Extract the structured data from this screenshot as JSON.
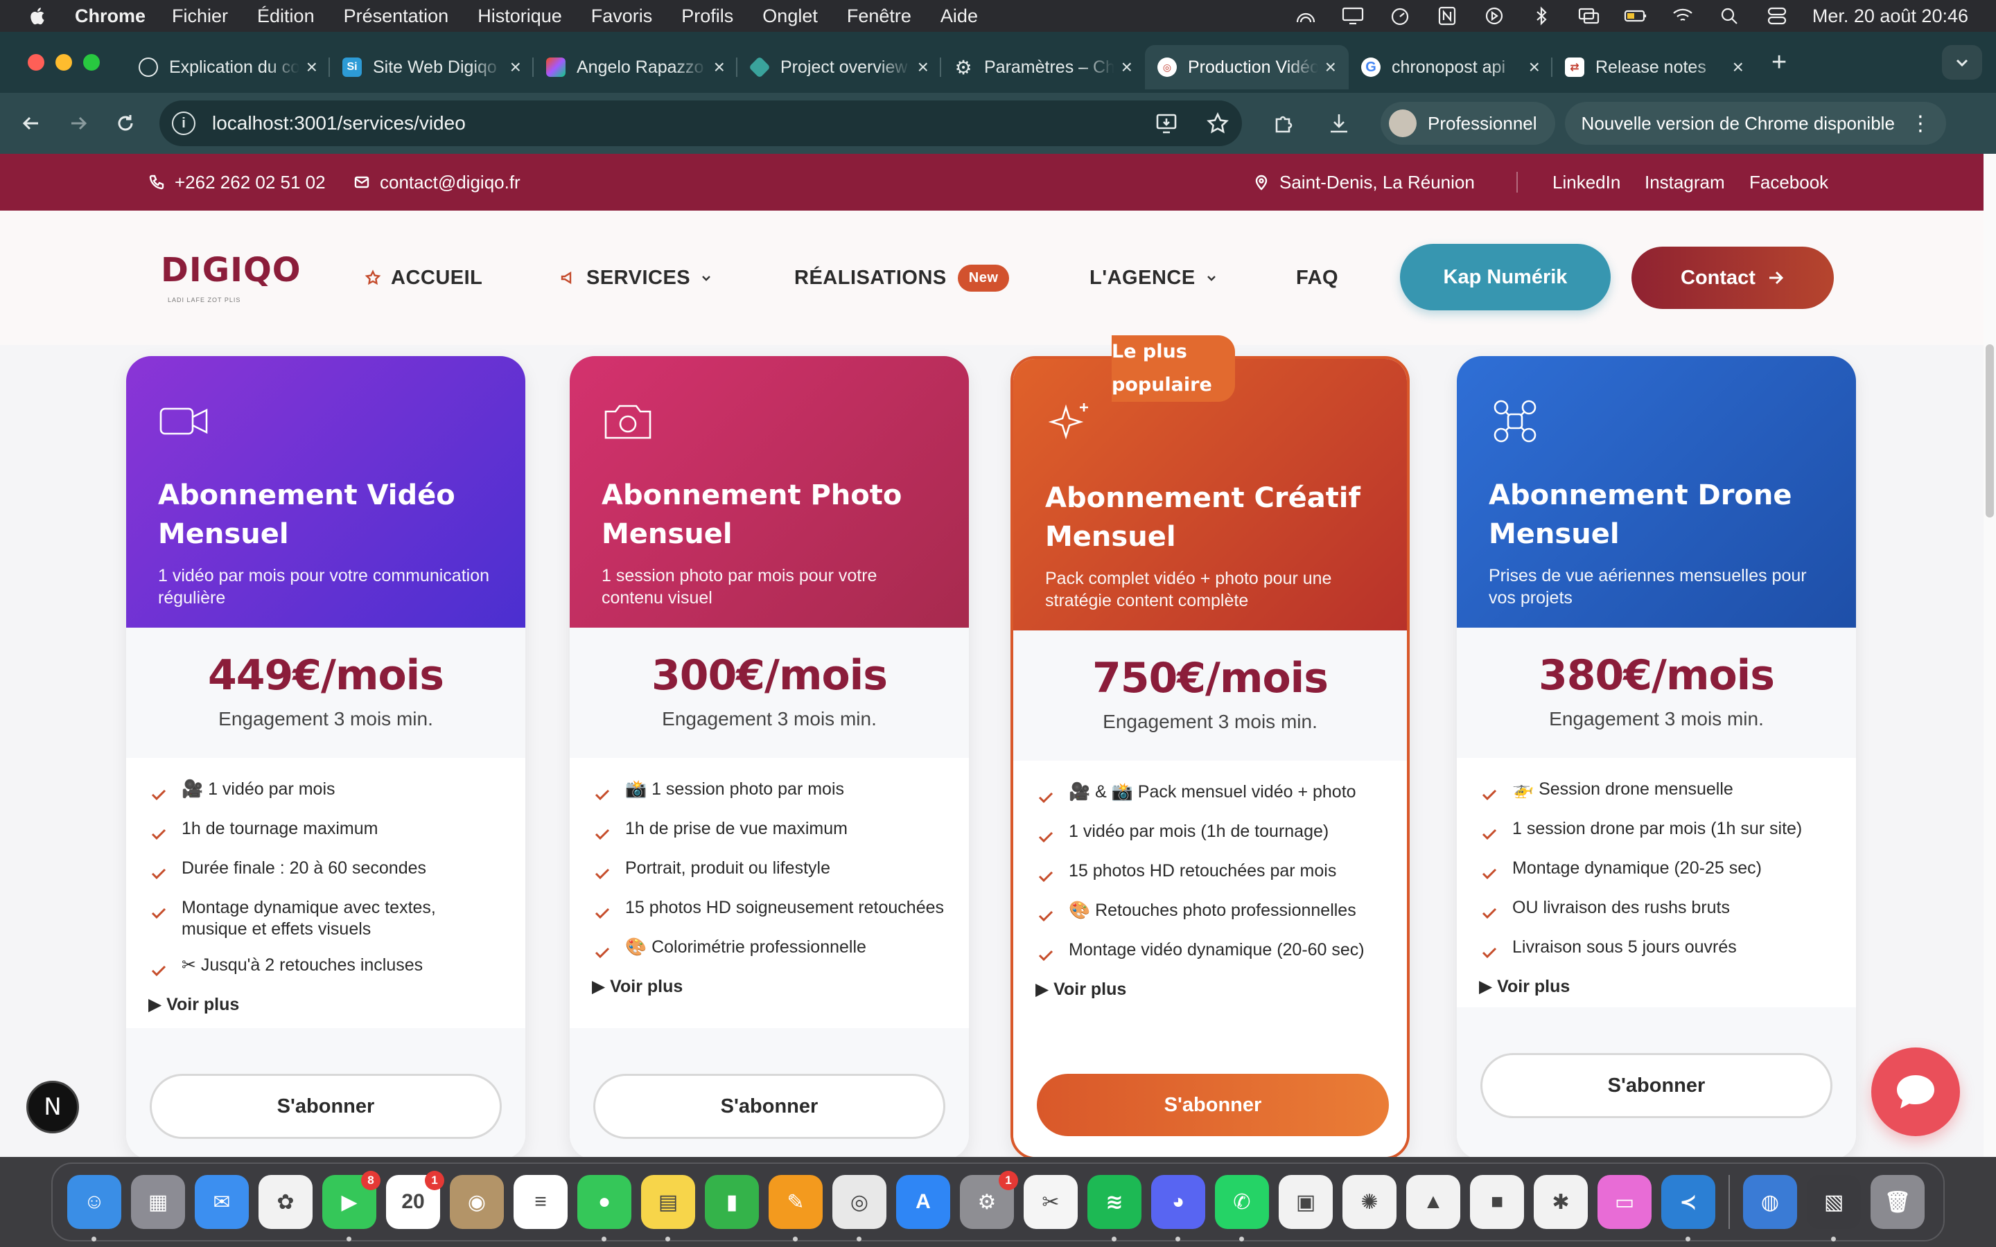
{
  "menubar": {
    "app": "Chrome",
    "items": [
      "Fichier",
      "Édition",
      "Présentation",
      "Historique",
      "Favoris",
      "Profils",
      "Onglet",
      "Fenêtre",
      "Aide"
    ],
    "datetime": "Mer. 20 août  20:46"
  },
  "tabs": [
    {
      "label": "Explication du code",
      "favicon": "openai-icon",
      "active": false
    },
    {
      "label": "Site Web Digiqo",
      "favicon": "si-icon",
      "active": false
    },
    {
      "label": "Angelo Rapazzo",
      "favicon": "figma-icon",
      "active": false
    },
    {
      "label": "Project overview",
      "favicon": "diamond-icon",
      "active": false
    },
    {
      "label": "Paramètres – Chrome",
      "favicon": "gear-icon",
      "active": false
    },
    {
      "label": "Production Vidéo",
      "favicon": "digiqo-icon",
      "active": true
    },
    {
      "label": "chronopost api",
      "favicon": "google-icon",
      "active": false
    },
    {
      "label": "Release notes",
      "favicon": "release-icon",
      "active": false
    }
  ],
  "toolbar": {
    "url": "localhost:3001/services/video",
    "profile": "Professionnel",
    "update": "Nouvelle version de Chrome disponible"
  },
  "topstrip": {
    "phone": "+262 262 02 51 02",
    "email": "contact@digiqo.fr",
    "location": "Saint-Denis, La Réunion",
    "socials": [
      "LinkedIn",
      "Instagram",
      "Facebook"
    ]
  },
  "header": {
    "logo": "DIGIQO",
    "logo_tagline": "LADI LAFE ZOT PLIS",
    "nav": {
      "home": "ACCUEIL",
      "services": "SERVICES",
      "realisations": "RÉALISATIONS",
      "new_badge": "New",
      "agency": "L'AGENCE",
      "faq": "FAQ"
    },
    "kap": "Kap Numérik",
    "contact": "Contact"
  },
  "popular_badge": "Le plus populaire",
  "plans": [
    {
      "title": "Abonnement Vidéo Mensuel",
      "subtitle": "1 vidéo par mois pour votre communication régulière",
      "price": "449€/mois",
      "engagement": "Engagement 3 mois min.",
      "features": [
        "🎥 1 vidéo par mois",
        "1h de tournage maximum",
        "Durée finale : 20 à 60 secondes",
        "Montage dynamique avec textes, musique et effets visuels",
        "✂ Jusqu'à 2 retouches incluses"
      ],
      "more": "▶ Voir plus",
      "cta": "S'abonner",
      "gradient": [
        "#8b35d6",
        "#4b2fd0"
      ],
      "icon": "video-camera-icon"
    },
    {
      "title": "Abonnement Photo Mensuel",
      "subtitle": "1 session photo par mois pour votre contenu visuel",
      "price": "300€/mois",
      "engagement": "Engagement 3 mois min.",
      "features": [
        "📸 1 session photo par mois",
        "1h de prise de vue maximum",
        "Portrait, produit ou lifestyle",
        "15 photos HD soigneusement retouchées",
        "🎨 Colorimétrie professionnelle"
      ],
      "more": "▶ Voir plus",
      "cta": "S'abonner",
      "gradient": [
        "#d4326e",
        "#a72a4e"
      ],
      "icon": "camera-icon"
    },
    {
      "title": "Abonnement Créatif Mensuel",
      "subtitle": "Pack complet vidéo + photo pour une stratégie content complète",
      "price": "750€/mois",
      "engagement": "Engagement 3 mois min.",
      "features": [
        "🎥 & 📸 Pack mensuel vidéo + photo",
        "1 vidéo par mois (1h de tournage)",
        "15 photos HD retouchées par mois",
        "🎨 Retouches photo professionnelles",
        "Montage vidéo dynamique (20-60 sec)"
      ],
      "more": "▶ Voir plus",
      "cta": "S'abonner",
      "gradient": [
        "#e0622a",
        "#b8322a"
      ],
      "icon": "sparkles-icon"
    },
    {
      "title": "Abonnement Drone Mensuel",
      "subtitle": "Prises de vue aériennes mensuelles pour vos projets",
      "price": "380€/mois",
      "engagement": "Engagement 3 mois min.",
      "features": [
        "🚁 Session drone mensuelle",
        "1 session drone par mois (1h sur site)",
        "Montage dynamique (20-25 sec)",
        "OU livraison des rushs bruts",
        "Livraison sous 5 jours ouvrés"
      ],
      "more": "▶ Voir plus",
      "cta": "S'abonner",
      "gradient": [
        "#2f6fd6",
        "#1e4fa8"
      ],
      "icon": "drone-icon"
    }
  ],
  "dock": {
    "apps": [
      {
        "name": "finder",
        "color": "#3a8ee6",
        "glyph": "☺",
        "badge": ""
      },
      {
        "name": "launchpad",
        "color": "#8c8c94",
        "glyph": "▦",
        "badge": ""
      },
      {
        "name": "mail",
        "color": "#3c8ff0",
        "glyph": "✉",
        "badge": ""
      },
      {
        "name": "photos",
        "color": "#f2f2f2",
        "glyph": "✿",
        "badge": ""
      },
      {
        "name": "facetime",
        "color": "#35c759",
        "glyph": "▶",
        "badge": "8"
      },
      {
        "name": "calendar",
        "color": "#ffffff",
        "glyph": "20",
        "badge": "1"
      },
      {
        "name": "contacts",
        "color": "#b39468",
        "glyph": "◉",
        "badge": ""
      },
      {
        "name": "reminders",
        "color": "#ffffff",
        "glyph": "≡",
        "badge": ""
      },
      {
        "name": "messages",
        "color": "#35c759",
        "glyph": "●",
        "badge": ""
      },
      {
        "name": "notes",
        "color": "#f7d54a",
        "glyph": "▤",
        "badge": ""
      },
      {
        "name": "numbers",
        "color": "#34b34a",
        "glyph": "▮",
        "badge": ""
      },
      {
        "name": "pages",
        "color": "#f39a1e",
        "glyph": "✎",
        "badge": ""
      },
      {
        "name": "chrome",
        "color": "#e8e8e8",
        "glyph": "◎",
        "badge": ""
      },
      {
        "name": "app-store",
        "color": "#2f86f5",
        "glyph": "A",
        "badge": ""
      },
      {
        "name": "system-settings",
        "color": "#8e8e93",
        "glyph": "⚙",
        "badge": "1"
      },
      {
        "name": "capcut",
        "color": "#f5f5f5",
        "glyph": "✂",
        "badge": ""
      },
      {
        "name": "spotify",
        "color": "#1db954",
        "glyph": "≋",
        "badge": ""
      },
      {
        "name": "discord",
        "color": "#5865f2",
        "glyph": "◕",
        "badge": ""
      },
      {
        "name": "whatsapp",
        "color": "#25d366",
        "glyph": "✆",
        "badge": ""
      },
      {
        "name": "google-chat",
        "color": "#f2f2f2",
        "glyph": "▣",
        "badge": ""
      },
      {
        "name": "google-photos",
        "color": "#f2f2f2",
        "glyph": "✺",
        "badge": ""
      },
      {
        "name": "google-drive",
        "color": "#f2f2f2",
        "glyph": "▲",
        "badge": ""
      },
      {
        "name": "google-meet",
        "color": "#f2f2f2",
        "glyph": "■",
        "badge": ""
      },
      {
        "name": "slack",
        "color": "#f2f2f2",
        "glyph": "✱",
        "badge": ""
      },
      {
        "name": "screen-recorder",
        "color": "#e86cd6",
        "glyph": "▭",
        "badge": ""
      },
      {
        "name": "vscode",
        "color": "#2b7fd4",
        "glyph": "≺",
        "badge": ""
      },
      {
        "name": "globe",
        "color": "#3a7bd5",
        "glyph": "◍",
        "badge": ""
      },
      {
        "name": "screenshot-stack",
        "color": "#3b3b3f",
        "glyph": "▧",
        "badge": ""
      },
      {
        "name": "trash",
        "color": "#8a8a90",
        "glyph": "🗑",
        "badge": ""
      }
    ]
  },
  "n_badge": "N"
}
